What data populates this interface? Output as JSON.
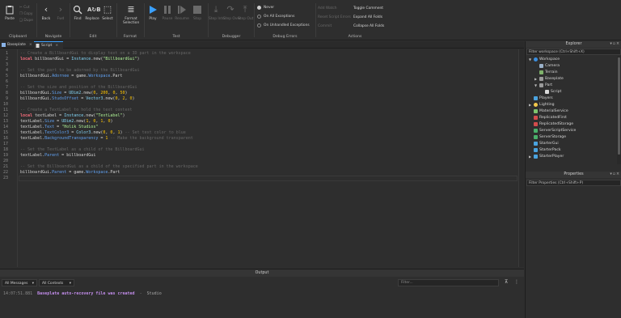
{
  "ribbon": {
    "clipboard": {
      "paste": "Paste",
      "cut": "Cut",
      "copy": "Copy",
      "duplicate": "Dupe",
      "label": "Clipboard"
    },
    "navigate": {
      "back": "Back",
      "fwd": "Fwd",
      "label": "Navigate"
    },
    "edit": {
      "find": "Find",
      "replace": "Replace",
      "select": "Select",
      "label": "Edit"
    },
    "format": {
      "format_selection": "Format Selection",
      "label": "Format"
    },
    "test": {
      "play": "Play",
      "pause": "Pause",
      "resume": "Resume",
      "stop": "Stop",
      "label": "Test"
    },
    "debugger": {
      "step_into": "Step Into",
      "step_over": "Step Over",
      "step_out": "Step Out",
      "label": "Debugger"
    },
    "debug_errors": {
      "never": "Never",
      "all": "On All Exceptions",
      "unhandled": "On Unhandled Exceptions",
      "label": "Debug Errors"
    },
    "actions": {
      "add_watch": "Add Watch",
      "reset": "Reset Script Errors",
      "commit": "Commit",
      "toggle_comment": "Toggle Comment",
      "expand_folds": "Expand All Folds",
      "collapse_folds": "Collapse All Folds",
      "label": "Actions"
    }
  },
  "tabs": [
    {
      "label": "Baseplate"
    },
    {
      "label": "Script"
    }
  ],
  "editor": {
    "line_numbers": [
      "1",
      "2",
      "3",
      "4",
      "5",
      "6",
      "7",
      "8",
      "9",
      "10",
      "11",
      "12",
      "13",
      "14",
      "15",
      "16",
      "17",
      "18",
      "19",
      "20",
      "21",
      "22",
      "23"
    ],
    "lines": {
      "l1": "-- Create a BillboardGui to display text on a 3D part in the workspace",
      "l2_kw": "local",
      "l2_a": " billboardGui = ",
      "l2_b": "Instance",
      "l2_c": ".new(",
      "l2_d": "\"BillboardGui\"",
      "l2_e": ")",
      "l4": "-- Set the part to be adorned by the BillboardGui",
      "l5_a": "billboardGui.",
      "l5_b": "Adornee",
      "l5_c": " = game.",
      "l5_d": "Workspace",
      "l5_e": ".Part",
      "l7": "-- Set the size and position of the BillboardGui",
      "l8_a": "billboardGui.",
      "l8_b": "Size",
      "l8_c": " = ",
      "l8_d": "UDim2",
      "l8_e": ".new(",
      "l8_f": "0",
      "l8_g": ", ",
      "l8_h": "200",
      "l8_i": ", ",
      "l8_j": "0",
      "l8_k": ", ",
      "l8_l": "50",
      "l8_m": ")",
      "l9_a": "billboardGui.",
      "l9_b": "StudsOffset",
      "l9_c": " = ",
      "l9_d": "Vector3",
      "l9_e": ".new(",
      "l9_f": "0",
      "l9_g": ", ",
      "l9_h": "2",
      "l9_i": ", ",
      "l9_j": "0",
      "l9_k": ")",
      "l11": "-- Create a TextLabel to hold the text content",
      "l12_kw": "local",
      "l12_a": " textLabel = ",
      "l12_b": "Instance",
      "l12_c": ".new(",
      "l12_d": "\"TextLabel\"",
      "l12_e": ")",
      "l13_a": "textLabel.",
      "l13_b": "Size",
      "l13_c": " = ",
      "l13_d": "UDim2",
      "l13_e": ".new(",
      "l13_f": "1",
      "l13_g": ", ",
      "l13_h": "0",
      "l13_i": ", ",
      "l13_j": "1",
      "l13_k": ", ",
      "l13_l": "0",
      "l13_m": ")",
      "l14_a": "textLabel.",
      "l14_b": "Text",
      "l14_c": " = ",
      "l14_d": "\"Holik Studios\"",
      "l15_a": "textLabel.",
      "l15_b": "TextColor3",
      "l15_c": " = ",
      "l15_d": "Color3",
      "l15_e": ".new(",
      "l15_f": "0",
      "l15_g": ", ",
      "l15_h": "0",
      "l15_i": ", ",
      "l15_j": "1",
      "l15_k": ") ",
      "l15_l": "-- Set text color to blue",
      "l16_a": "textLabel.",
      "l16_b": "BackgroundTransparency",
      "l16_c": " = ",
      "l16_d": "1",
      "l16_e": " ",
      "l16_f": "-- Make the background transparent",
      "l18": "-- Set the TextLabel as a child of the BillboardGui",
      "l19_a": "textLabel.",
      "l19_b": "Parent",
      "l19_c": " = billboardGui",
      "l21": "-- Set the BillboardGui as a child of the specified part in the workspace",
      "l22_a": "billboardGui.",
      "l22_b": "Parent",
      "l22_c": " = game.",
      "l22_d": "Workspace",
      "l22_e": ".Part"
    }
  },
  "output": {
    "title": "Output",
    "messages_dd": "All Messages",
    "contexts_dd": "All Contexts",
    "filter_placeholder": "Filter...",
    "time": "14:07:51.881",
    "message": "Baseplate auto-recovery file was created",
    "sep": "  -  ",
    "source": "Studio"
  },
  "explorer": {
    "title": "Explorer",
    "filter": "Filter workspace (Ctrl+Shift+X)",
    "items": [
      {
        "label": "Workspace",
        "color": "#3b8fe0"
      },
      {
        "label": "Camera",
        "color": "#9ab0c8"
      },
      {
        "label": "Terrain",
        "color": "#7fb26b"
      },
      {
        "label": "Baseplate",
        "color": "#9a9a9a"
      },
      {
        "label": "Part",
        "color": "#9a9a9a"
      },
      {
        "label": "Script",
        "color": "#d9d9d9"
      },
      {
        "label": "Players",
        "color": "#4aa3df"
      },
      {
        "label": "Lighting",
        "color": "#f2c84b"
      },
      {
        "label": "MaterialService",
        "color": "#7ec46e"
      },
      {
        "label": "ReplicatedFirst",
        "color": "#d44c4c"
      },
      {
        "label": "ReplicatedStorage",
        "color": "#d44c4c"
      },
      {
        "label": "ServerScriptService",
        "color": "#4ab06a"
      },
      {
        "label": "ServerStorage",
        "color": "#4ab06a"
      },
      {
        "label": "StarterGui",
        "color": "#4aa3df"
      },
      {
        "label": "StarterPack",
        "color": "#4aa3df"
      },
      {
        "label": "StarterPlayer",
        "color": "#4aa3df"
      }
    ]
  },
  "properties": {
    "title": "Properties",
    "filter": "Filter Properties (Ctrl+Shift+P)"
  },
  "colors": {
    "accent": "#3aa0ff",
    "play": "#3aa0ff",
    "background": "#2e2e2e"
  }
}
